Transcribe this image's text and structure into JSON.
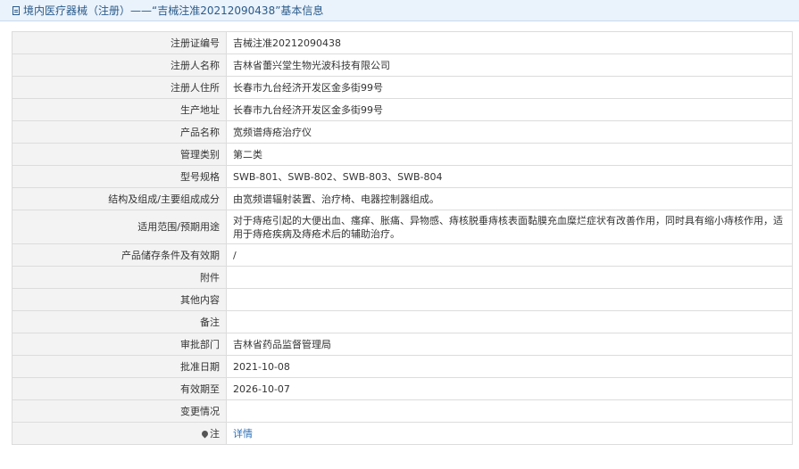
{
  "header": {
    "title": "境内医疗器械（注册）——“吉械注准20212090438”基本信息"
  },
  "rows": [
    {
      "label": "注册证编号",
      "value": "吉械注准20212090438"
    },
    {
      "label": "注册人名称",
      "value": "吉林省蕾兴堂生物光波科技有限公司"
    },
    {
      "label": "注册人住所",
      "value": "长春市九台经济开发区金多街99号"
    },
    {
      "label": "生产地址",
      "value": "长春市九台经济开发区金多街99号"
    },
    {
      "label": "产品名称",
      "value": "宽频谱痔疮治疗仪"
    },
    {
      "label": "管理类别",
      "value": "第二类"
    },
    {
      "label": "型号规格",
      "value": "SWB-801、SWB-802、SWB-803、SWB-804"
    },
    {
      "label": "结构及组成/主要组成成分",
      "value": "由宽频谱辐射装置、治疗椅、电器控制器组成。"
    },
    {
      "label": "适用范围/预期用途",
      "value": "对于痔疮引起的大便出血、瘙痒、胀痛、异物感、痔核脱垂痔核表面黏膜充血糜烂症状有改善作用，同时具有缩小痔核作用，适用于痔疮疾病及痔疮术后的辅助治疗。"
    },
    {
      "label": "产品储存条件及有效期",
      "value": "/"
    },
    {
      "label": "附件",
      "value": ""
    },
    {
      "label": "其他内容",
      "value": ""
    },
    {
      "label": "备注",
      "value": ""
    },
    {
      "label": "审批部门",
      "value": "吉林省药品监督管理局"
    },
    {
      "label": "批准日期",
      "value": "2021-10-08"
    },
    {
      "label": "有效期至",
      "value": "2026-10-07"
    },
    {
      "label": "变更情况",
      "value": ""
    }
  ],
  "note": {
    "label": "注",
    "link_text": "详情",
    "icon": "pin-icon"
  }
}
